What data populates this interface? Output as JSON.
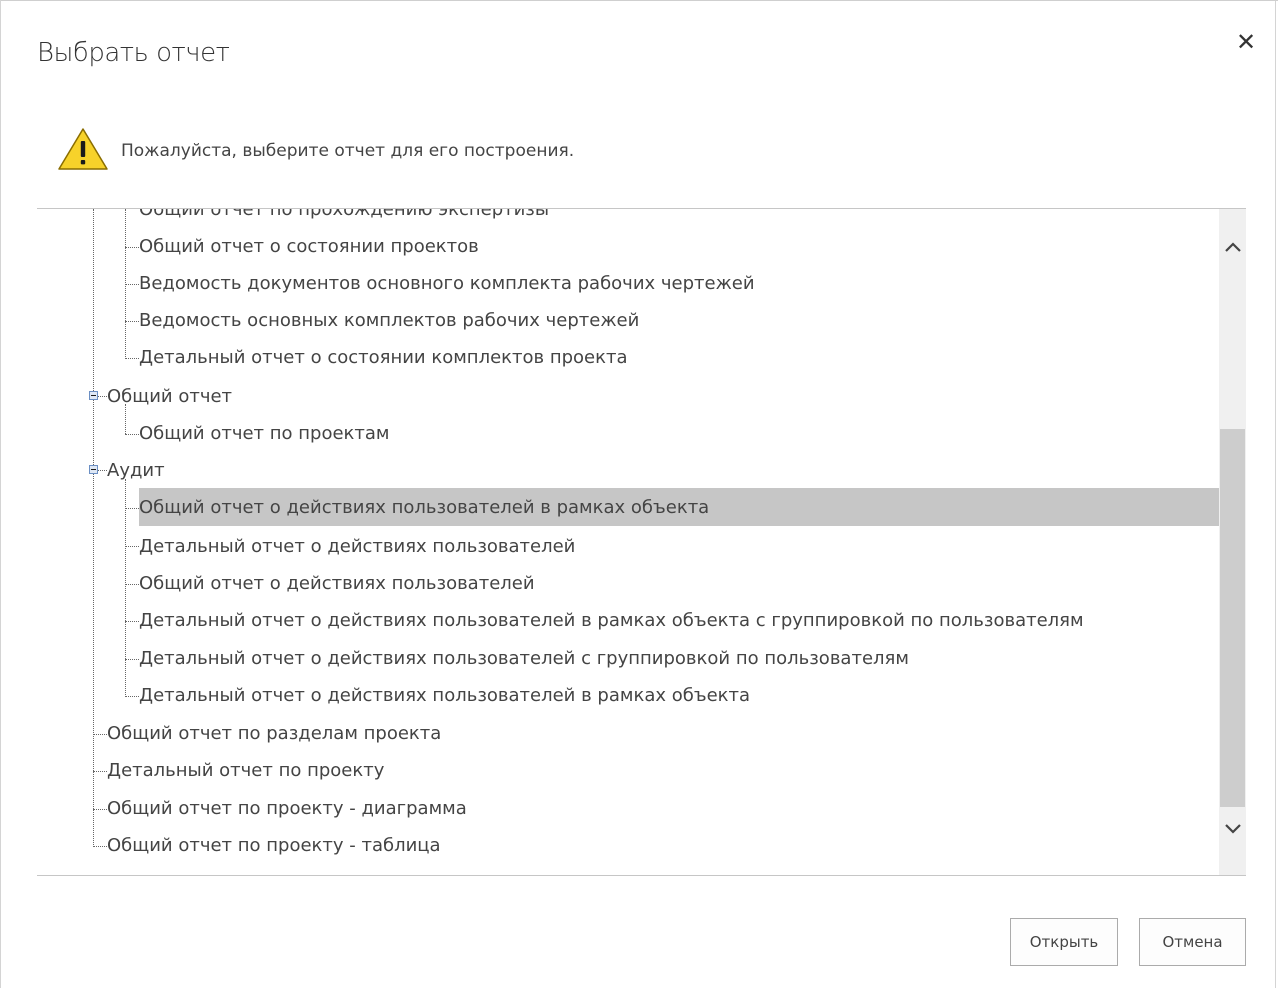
{
  "dialog": {
    "title": "Выбрать отчет",
    "close_label": "✕",
    "message": "Пожалуйста, выберите отчет для его построения."
  },
  "tree": {
    "items": [
      {
        "label": "Общий отчет по прохождению экспертизы",
        "level": 2
      },
      {
        "label": "Общий отчет о состоянии проектов",
        "level": 2
      },
      {
        "label": "Ведомость документов основного комплекта рабочих чертежей",
        "level": 2
      },
      {
        "label": "Ведомость основных комплектов рабочих чертежей",
        "level": 2
      },
      {
        "label": "Детальный отчет о состоянии комплектов проекта",
        "level": 2
      },
      {
        "label": "Общий отчет",
        "level": 1,
        "expanded": true
      },
      {
        "label": "Общий отчет по проектам",
        "level": 2
      },
      {
        "label": "Аудит",
        "level": 1,
        "expanded": true
      },
      {
        "label": "Общий отчет о действиях пользователей в рамках объекта",
        "level": 2,
        "selected": true
      },
      {
        "label": "Детальный отчет о действиях пользователей",
        "level": 2
      },
      {
        "label": "Общий отчет о действиях пользователей",
        "level": 2
      },
      {
        "label": "Детальный отчет о действиях пользователей в рамках объекта с группировкой по пользователям",
        "level": 2
      },
      {
        "label": "Детальный отчет о действиях пользователей с группировкой по пользователям",
        "level": 2
      },
      {
        "label": "Детальный отчет о действиях пользователей в рамках объекта",
        "level": 2
      },
      {
        "label": "Общий отчет по разделам проекта",
        "level": 1
      },
      {
        "label": "Детальный отчет по проекту",
        "level": 1
      },
      {
        "label": "Общий отчет по проекту - диаграмма",
        "level": 1
      },
      {
        "label": "Общий отчет по проекту - таблица",
        "level": 1
      }
    ]
  },
  "scrollbar": {
    "up_icon": "chevron-up-icon",
    "down_icon": "chevron-down-icon"
  },
  "buttons": {
    "open_label": "Открыть",
    "cancel_label": "Отмена"
  },
  "colors": {
    "selection": "#c6c6c6",
    "warning_fill": "#f7d22a",
    "text": "#444444"
  }
}
